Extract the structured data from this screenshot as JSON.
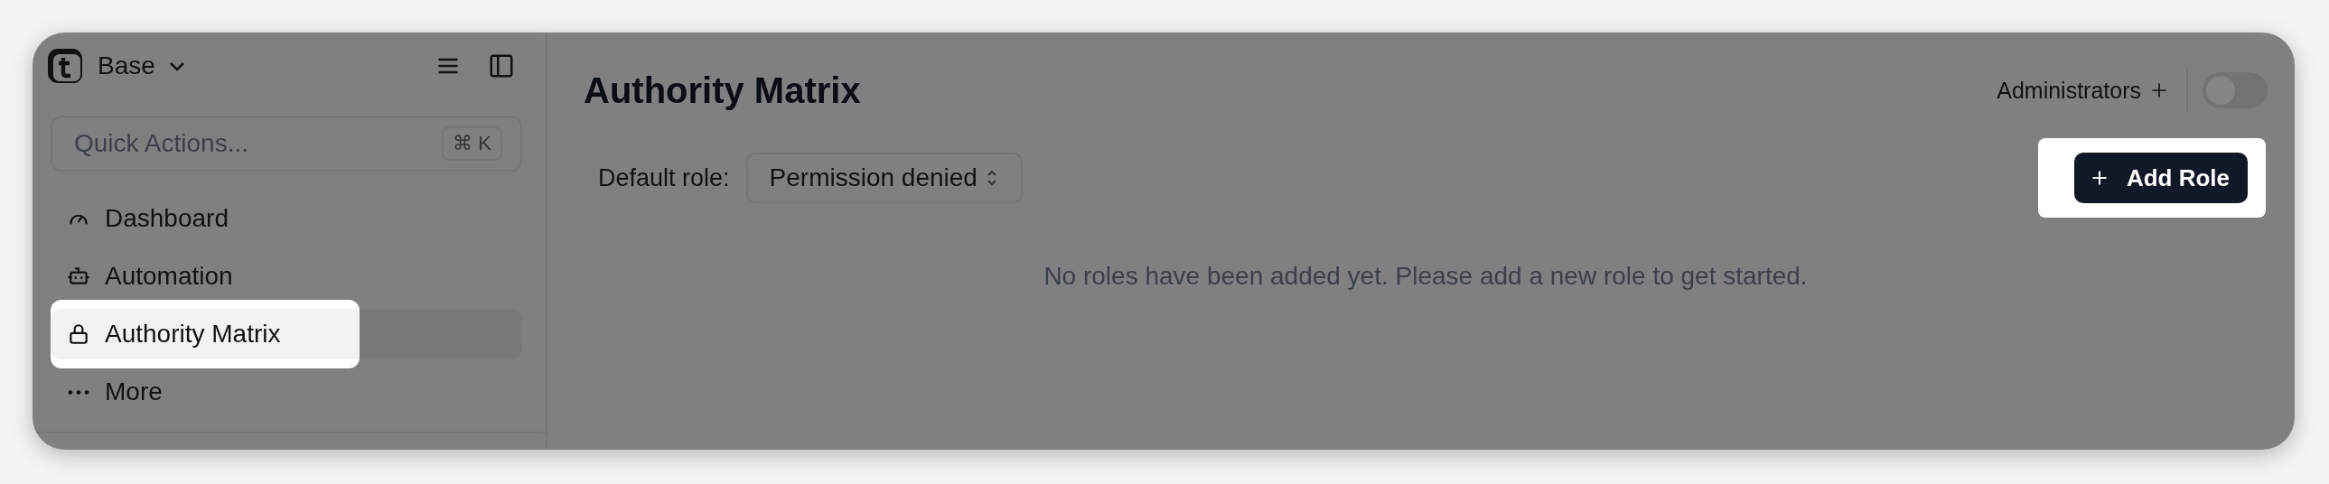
{
  "sidebar": {
    "workspace": "Base",
    "search": {
      "placeholder": "Quick Actions...",
      "shortcut": "⌘ K"
    },
    "items": [
      {
        "kind": "gauge",
        "label": "Dashboard",
        "selected": false,
        "highlighted": false
      },
      {
        "kind": "robot",
        "label": "Automation",
        "selected": false,
        "highlighted": false
      },
      {
        "kind": "lock",
        "label": "Authority Matrix",
        "selected": true,
        "highlighted": true
      },
      {
        "kind": "dots",
        "label": "More",
        "selected": false,
        "highlighted": false
      }
    ]
  },
  "main": {
    "title": "Authority Matrix",
    "admins": "Administrators",
    "toggle": {
      "on": false
    },
    "default_role": {
      "label": "Default role:",
      "value": "Permission denied"
    },
    "add_button": {
      "label": "Add Role",
      "highlighted": true
    },
    "empty_message": "No roles have been added yet. Please add a new role to get started."
  }
}
